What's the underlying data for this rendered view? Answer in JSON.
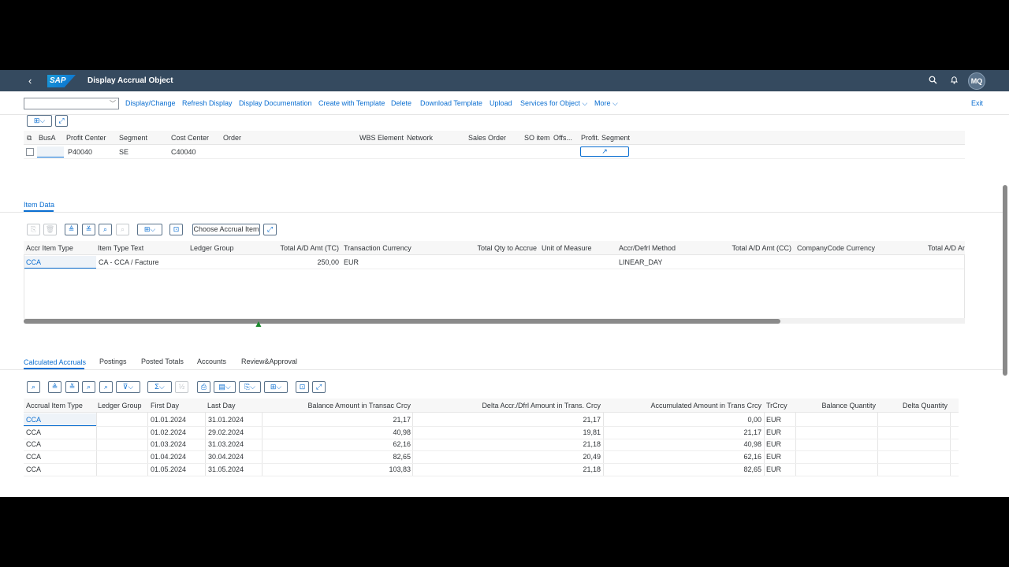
{
  "shell": {
    "back_icon": "‹",
    "logo": "SAP",
    "title": "Display Accrual Object",
    "search_icon": "⌕",
    "bell_icon": "🔔",
    "avatar": "MQ"
  },
  "toolbar": {
    "select_value": "",
    "items": [
      "Display/Change",
      "Refresh Display",
      "Display Documentation",
      "Create with Template",
      "Delete",
      "Download Template",
      "Upload",
      "Services for Object",
      "More"
    ],
    "exit": "Exit"
  },
  "acct_table": {
    "headers": [
      "BusA",
      "Profit Center",
      "Segment",
      "Cost Center",
      "Order",
      "WBS Element",
      "Network",
      "Sales Order",
      "SO item",
      "Offs...",
      "Profit. Segment"
    ],
    "row": {
      "busa": "",
      "profit_center": "P40040",
      "segment": "SE",
      "cost_center": "C40040",
      "profit_segment_icon": "↗"
    }
  },
  "item_tab": {
    "label": "Item Data"
  },
  "item_table": {
    "choose_btn": "Choose Accrual Item",
    "headers": [
      "Accr Item Type",
      "Item Type Text",
      "Ledger Group",
      "Total A/D Amt (TC)",
      "Transaction Currency",
      "Total Qty to Accrue",
      "Unit of Measure",
      "Accr/Defrl Method",
      "Total A/D Amt (CC)",
      "CompanyCode Currency",
      "Total A/D Am"
    ],
    "row": {
      "type": "CCA",
      "text": "CA - CCA / Facture",
      "ledger": "",
      "amount": "250,00",
      "currency": "EUR",
      "method": "LINEAR_DAY"
    }
  },
  "bottom_tabs": [
    "Calculated Accruals",
    "Postings",
    "Posted Totals",
    "Accounts",
    "Review&Approval"
  ],
  "accruals_table": {
    "headers": [
      "Accrual Item Type",
      "Ledger Group",
      "First Day",
      "Last Day",
      "Balance Amount in Transac Crcy",
      "Delta Accr./Dfrl Amount in Trans. Crcy",
      "Accumulated Amount in Trans Crcy",
      "TrCrcy",
      "Balance Quantity",
      "Delta Quantity"
    ],
    "rows": [
      {
        "type": "CCA",
        "ledger": "",
        "first": "01.01.2024",
        "last": "31.01.2024",
        "balance": "21,17",
        "delta": "21,17",
        "accum": "0,00",
        "cur": "EUR"
      },
      {
        "type": "CCA",
        "ledger": "",
        "first": "01.02.2024",
        "last": "29.02.2024",
        "balance": "40,98",
        "delta": "19,81",
        "accum": "21,17",
        "cur": "EUR"
      },
      {
        "type": "CCA",
        "ledger": "",
        "first": "01.03.2024",
        "last": "31.03.2024",
        "balance": "62,16",
        "delta": "21,18",
        "accum": "40,98",
        "cur": "EUR"
      },
      {
        "type": "CCA",
        "ledger": "",
        "first": "01.04.2024",
        "last": "30.04.2024",
        "balance": "82,65",
        "delta": "20,49",
        "accum": "62,16",
        "cur": "EUR"
      },
      {
        "type": "CCA",
        "ledger": "",
        "first": "01.05.2024",
        "last": "31.05.2024",
        "balance": "103,83",
        "delta": "21,18",
        "accum": "82,65",
        "cur": "EUR"
      }
    ]
  },
  "colors": {
    "shell": "#354a5f",
    "link": "#0a6ed1"
  }
}
